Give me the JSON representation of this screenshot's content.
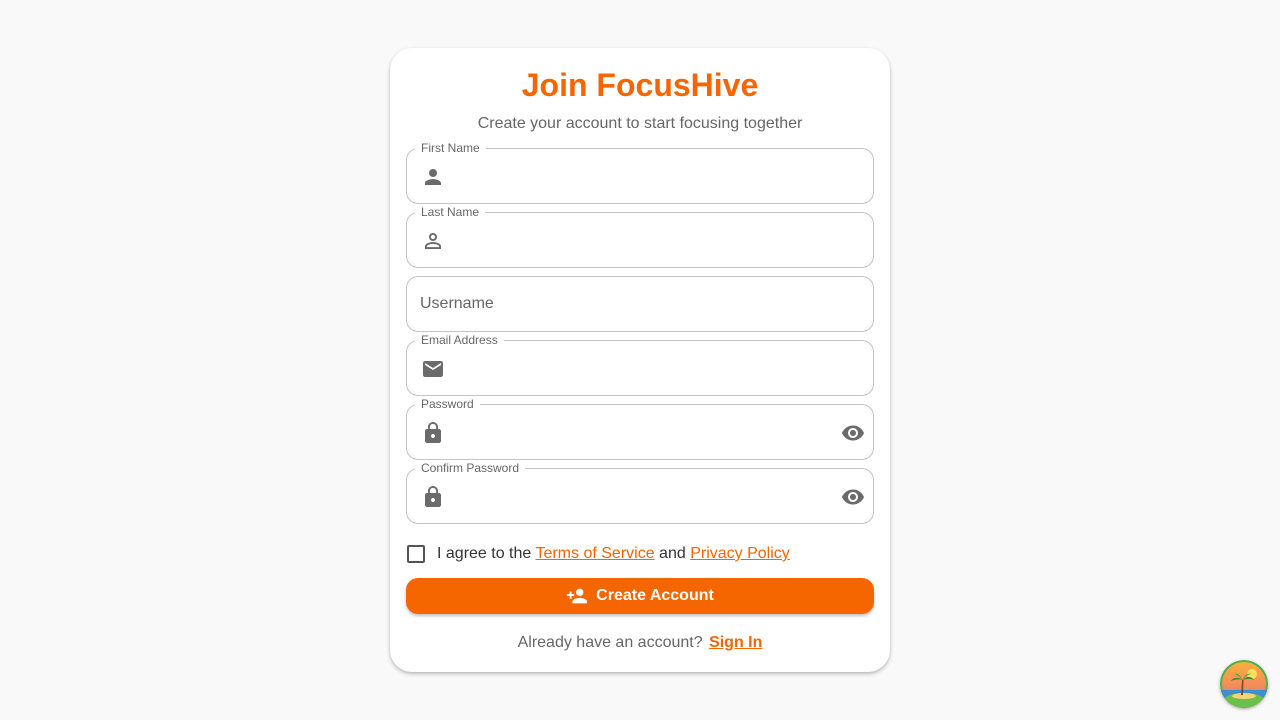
{
  "header": {
    "title": "Join FocusHive",
    "subtitle": "Create your account to start focusing together"
  },
  "form": {
    "first_name": {
      "label": "First Name",
      "value": "",
      "icon": "person-icon"
    },
    "last_name": {
      "label": "Last Name",
      "value": "",
      "icon": "person-outline-icon"
    },
    "username": {
      "placeholder": "Username",
      "value": ""
    },
    "email": {
      "label": "Email Address",
      "value": "",
      "icon": "mail-icon"
    },
    "password": {
      "label": "Password",
      "value": "",
      "icon": "lock-icon",
      "toggle_icon": "eye-icon"
    },
    "confirm_password": {
      "label": "Confirm Password",
      "value": "",
      "icon": "lock-icon",
      "toggle_icon": "eye-icon"
    }
  },
  "terms": {
    "checked": false,
    "prefix": "I agree to the",
    "tos_link": "Terms of Service",
    "and": "and",
    "privacy_link": "Privacy Policy"
  },
  "actions": {
    "create_label": "Create Account",
    "create_icon": "person-add-icon"
  },
  "footer": {
    "prompt": "Already have an account?",
    "signin_link": "Sign In"
  },
  "colors": {
    "accent": "#f56500",
    "background": "#f9f9f9",
    "card": "#ffffff",
    "muted_text": "#666666",
    "border": "#c4c4c4"
  }
}
